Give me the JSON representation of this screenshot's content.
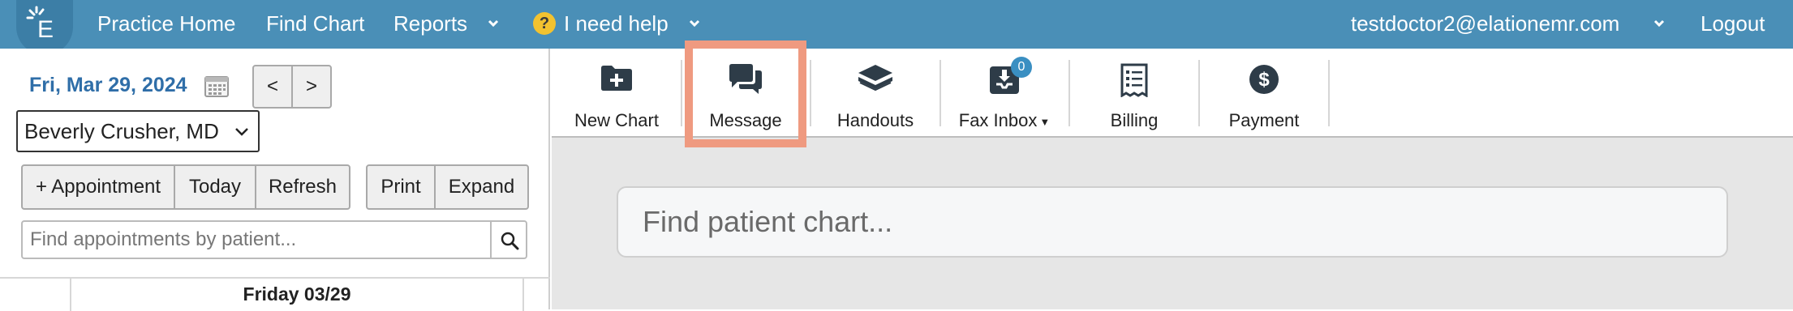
{
  "nav": {
    "practice_home": "Practice Home",
    "find_chart": "Find Chart",
    "reports": "Reports",
    "help_icon_glyph": "?",
    "help": "I need help",
    "user_email": "testdoctor2@elationemr.com",
    "logout": "Logout",
    "bar_color": "#4a8fb7",
    "logo_icon": "elation-e-logo"
  },
  "schedule": {
    "date": "Fri, Mar 29, 2024",
    "prev": "<",
    "next": ">",
    "provider": "Beverly Crusher, MD",
    "add_appointment": "+ Appointment",
    "today": "Today",
    "refresh": "Refresh",
    "print": "Print",
    "expand": "Expand",
    "search_placeholder": "Find appointments by patient...",
    "day_header": "Friday 03/29"
  },
  "toolbar": {
    "items": [
      {
        "label": "New Chart",
        "icon": "folder-plus-icon"
      },
      {
        "label": "Message",
        "icon": "chat-bubbles-icon"
      },
      {
        "label": "Handouts",
        "icon": "book-stack-icon"
      },
      {
        "label": "Fax Inbox",
        "icon": "fax-inbox-icon"
      },
      {
        "label": "Billing",
        "icon": "billing-list-icon"
      },
      {
        "label": "Payment",
        "icon": "dollar-circle-icon"
      }
    ],
    "fax_count": "0",
    "highlight_color": "#ef9a80"
  },
  "main": {
    "chart_search_placeholder": "Find patient chart..."
  }
}
